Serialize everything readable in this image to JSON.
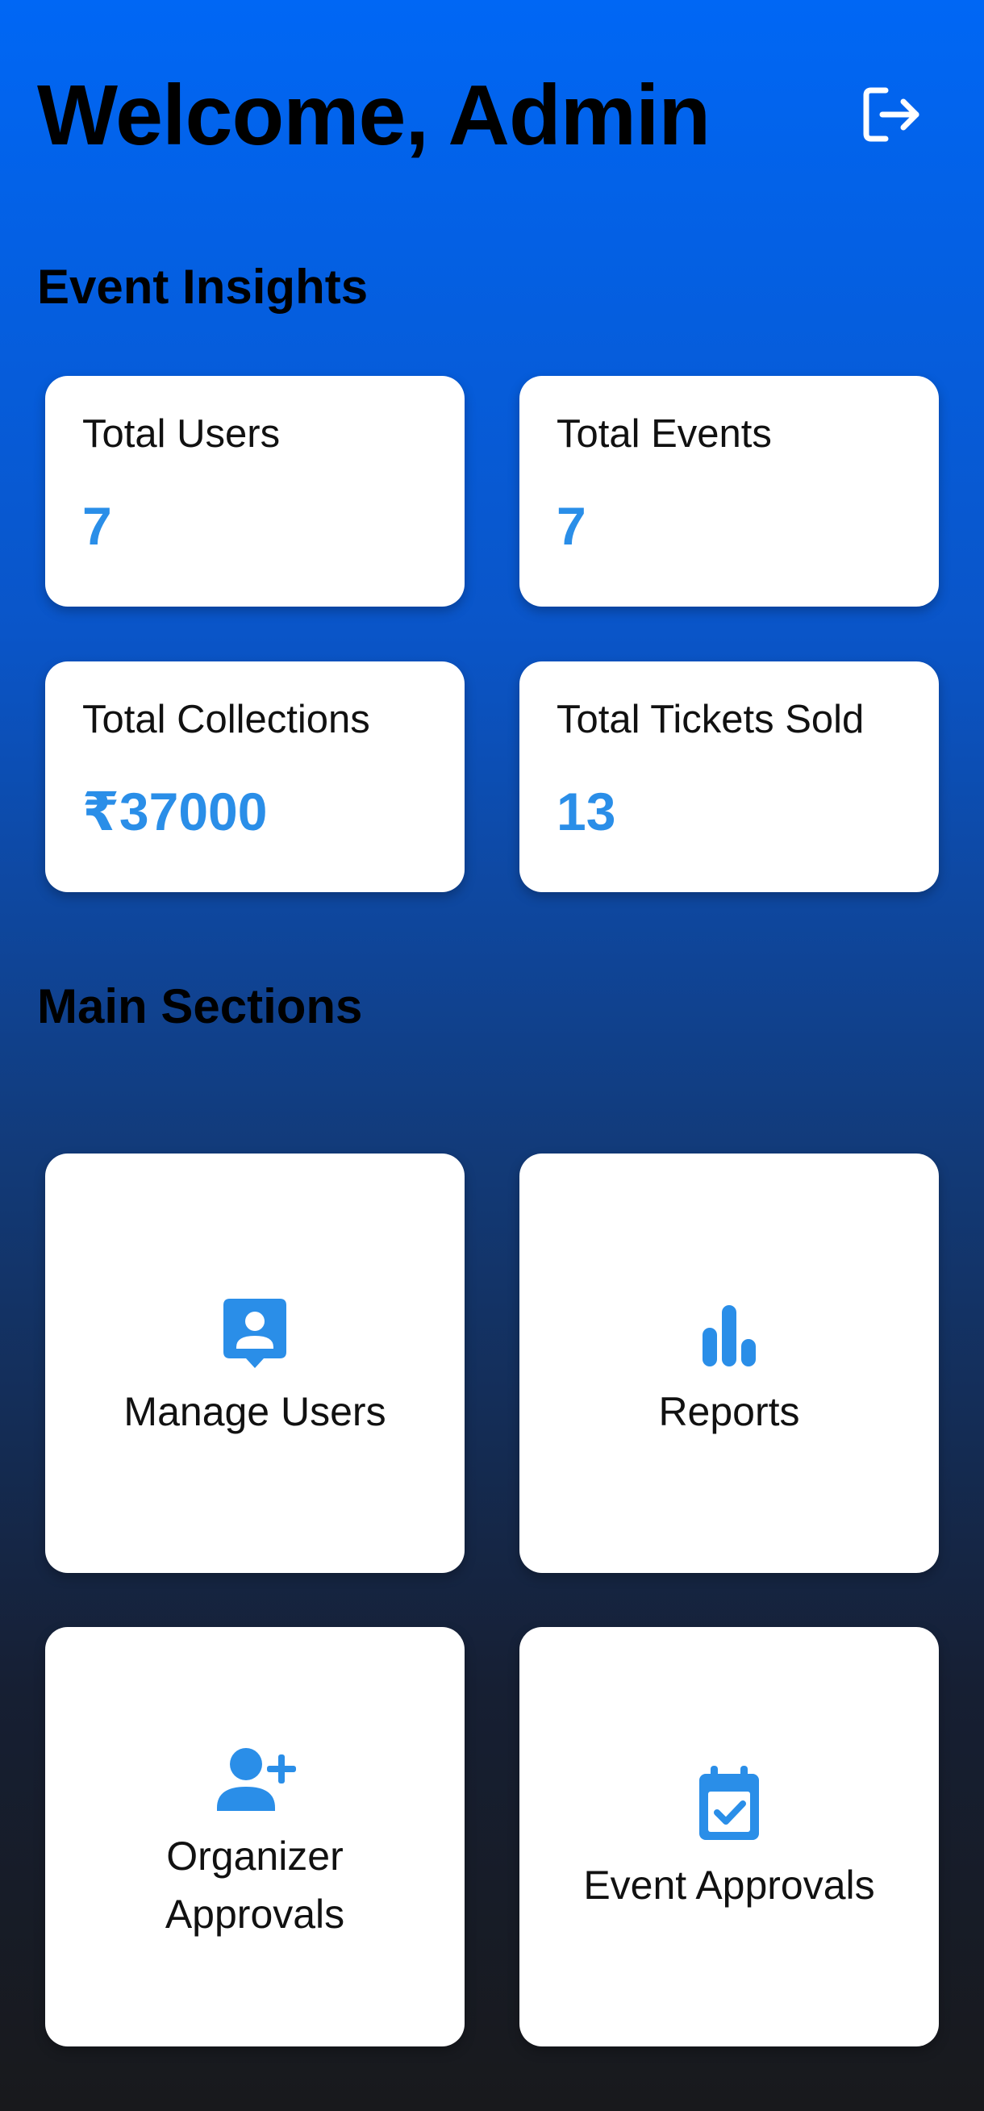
{
  "header": {
    "title": "Welcome, Admin",
    "logout_icon": "logout-icon"
  },
  "insights": {
    "title": "Event Insights",
    "cards": [
      {
        "label": "Total Users",
        "value": "7"
      },
      {
        "label": "Total Events",
        "value": "7"
      },
      {
        "label": "Total Collections",
        "value": "₹37000"
      },
      {
        "label": "Total Tickets Sold",
        "value": "13"
      }
    ]
  },
  "main": {
    "title": "Main Sections",
    "items": [
      {
        "label": "Manage Users",
        "icon": "contact-user-icon"
      },
      {
        "label": "Reports",
        "icon": "bar-chart-icon"
      },
      {
        "label": "Organizer Approvals",
        "icon": "add-person-icon"
      },
      {
        "label": "Event Approvals",
        "icon": "calendar-check-icon"
      }
    ]
  },
  "colors": {
    "accent": "#2a8ee8",
    "gradient_top": "#0067f5",
    "gradient_bottom": "#18191c",
    "card": "#ffffff"
  }
}
